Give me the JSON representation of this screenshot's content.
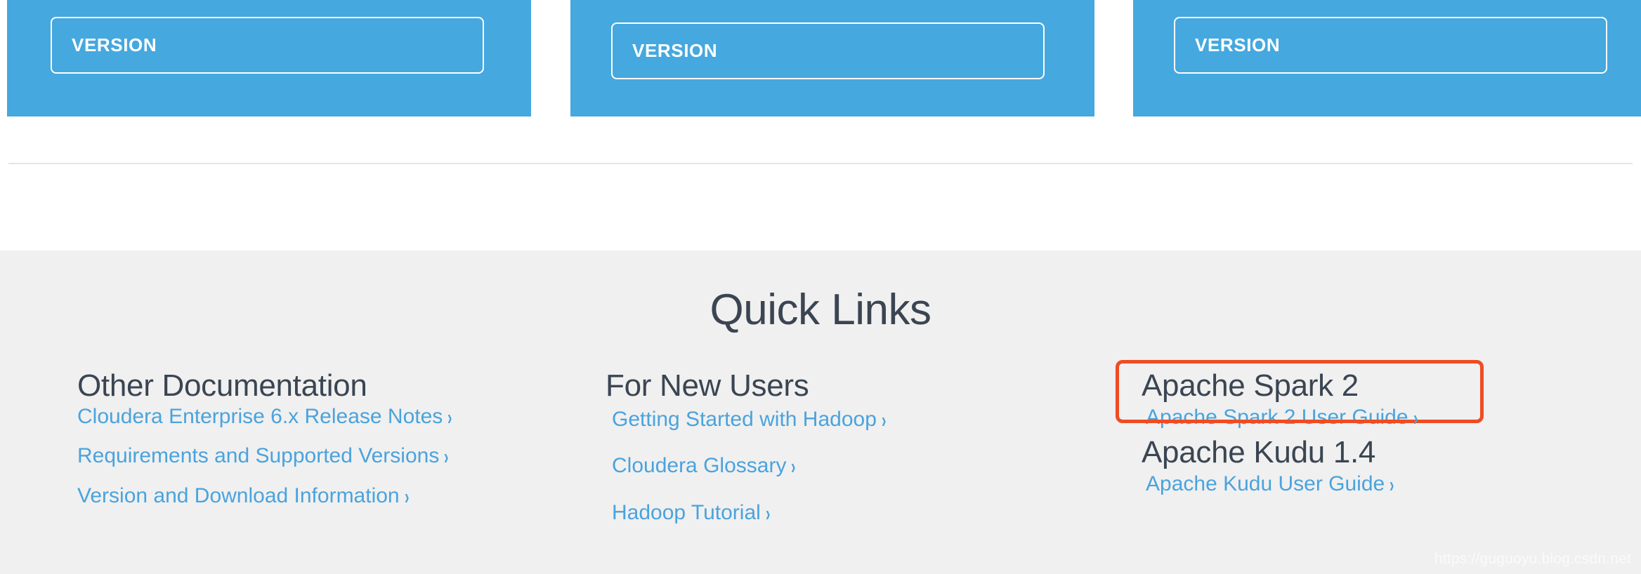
{
  "version_cards": [
    {
      "button_label": "VERSION"
    },
    {
      "button_label": "VERSION"
    },
    {
      "button_label": "VERSION"
    }
  ],
  "quick_links": {
    "title": "Quick Links",
    "columns": [
      {
        "heading": "Other Documentation",
        "links": [
          "Cloudera Enterprise 6.x Release Notes",
          "Requirements and Supported Versions",
          "Version and Download Information"
        ]
      },
      {
        "heading": "For New Users",
        "links": [
          "Getting Started with Hadoop",
          "Cloudera Glossary",
          "Hadoop Tutorial"
        ]
      }
    ],
    "product_groups": [
      {
        "heading": "Apache Spark 2",
        "links": [
          "Apache Spark 2 User Guide"
        ],
        "highlighted": true
      },
      {
        "heading": "Apache Kudu 1.4",
        "links": [
          "Apache Kudu User Guide"
        ],
        "highlighted": false
      }
    ]
  },
  "icons": {
    "chevron_right": "›"
  },
  "colors": {
    "card_blue": "#45a8de",
    "link_blue": "#4aa3dd",
    "heading_dark": "#3b4552",
    "section_gray": "#f0f0f0",
    "highlight_red": "#ef4c23",
    "divider_gray": "#e3e4e6"
  },
  "watermark": "https://guguoyu.blog.csdn.net"
}
